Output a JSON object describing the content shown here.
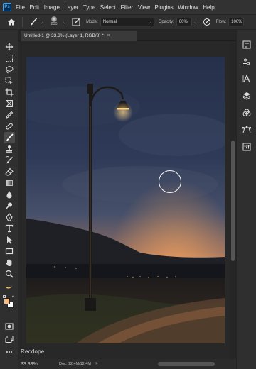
{
  "app": {
    "logo": "Ps"
  },
  "menu": [
    "File",
    "Edit",
    "Image",
    "Layer",
    "Type",
    "Select",
    "Filter",
    "View",
    "Plugins",
    "Window",
    "Help"
  ],
  "options": {
    "brush_size": "250",
    "mode_label": "Mode:",
    "mode_value": "Normal",
    "opacity_label": "Opacity:",
    "opacity_value": "60%",
    "flow_label": "Flow:",
    "flow_value": "100%"
  },
  "document": {
    "tab_title": "Untitled-1 @ 33.3% (Layer 1, RGB/8) *",
    "close_glyph": "×"
  },
  "canvas": {
    "watermark": "Recdope",
    "colors": {
      "sky_top": "#2a3550",
      "horizon_glow": "#e0874a",
      "lamp_light": "#ffcf7a"
    }
  },
  "status": {
    "zoom": "33.33%",
    "doc_info": "Doc: 12.4M/12.4M",
    "arrow": ">"
  },
  "icons": {
    "toolbar": [
      "move-icon",
      "marquee-icon",
      "lasso-icon",
      "object-select-icon",
      "crop-icon",
      "frame-icon",
      "eyedropper-icon",
      "healing-brush-icon",
      "brush-icon",
      "clone-stamp-icon",
      "history-brush-icon",
      "eraser-icon",
      "gradient-icon",
      "blur-icon",
      "dodge-icon",
      "pen-icon",
      "type-icon",
      "path-select-icon",
      "rectangle-icon",
      "hand-icon",
      "zoom-icon",
      "banana-icon",
      "color-swatches-icon",
      "quick-mask-icon",
      "screen-mode-icon"
    ],
    "right": [
      "history-panel-icon",
      "adjustments-panel-icon",
      "character-panel-icon",
      "layers-panel-icon",
      "channels-panel-icon",
      "paths-panel-icon",
      "properties-panel-icon"
    ]
  },
  "foreground_color": "#f5b887",
  "background_color": "#ffffff"
}
